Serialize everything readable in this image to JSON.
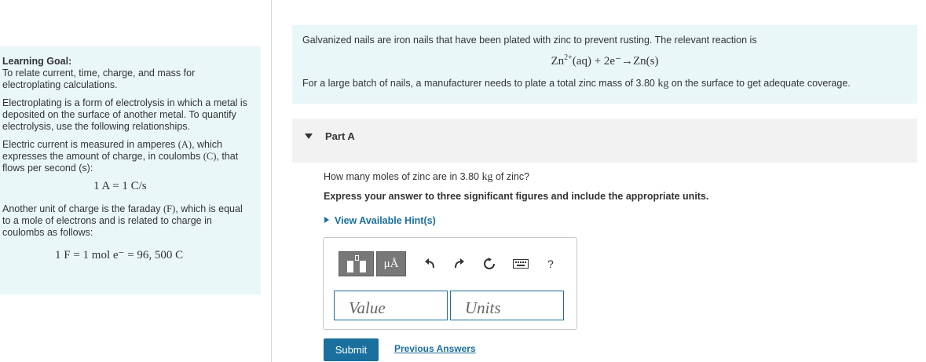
{
  "sidebar": {
    "goal_title": "Learning Goal:",
    "goal_text": "To relate current, time, charge, and mass for electroplating calculations.",
    "para1": "Electroplating is a form of electrolysis in which a metal is deposited on the surface of another metal. To quantify electrolysis, use the following relationships.",
    "para2_a": "Electric current is measured in amperes ",
    "para2_unit_a": "(A)",
    "para2_b": ", which expresses the amount of charge, in coulombs ",
    "para2_unit_c": "(C)",
    "para2_c": ", that flows per second (s):",
    "equation1": "1 A = 1 C/s",
    "para3_a": "Another unit of charge is the faraday ",
    "para3_unit_f": "(F)",
    "para3_b": ", which is equal to a mole of electrons and is related to charge in coulombs as follows:",
    "equation2": "1 F = 1 mol e⁻ = 96, 500 C"
  },
  "intro": {
    "text1": "Galvanized nails are iron nails that have been plated with zinc to prevent rusting. The relevant reaction is",
    "reaction_base": "Zn",
    "reaction_charge": "2+",
    "reaction_rest": "(aq) + 2e⁻→Zn(s)",
    "text2_a": "For a large batch of nails, a manufacturer needs to plate a total zinc mass of 3.80 ",
    "text2_unit": "kg",
    "text2_b": " on the surface to get adequate coverage."
  },
  "part": {
    "label": "Part A",
    "question_a": "How many moles of zinc are in 3.80 ",
    "question_unit": "kg",
    "question_b": " of zinc?",
    "instructions": "Express your answer to three significant figures and include the appropriate units.",
    "hints_label": "View Available Hint(s)"
  },
  "toolbar": {
    "units_button_label": "μÅ",
    "icons": [
      "templates-icon",
      "units-icon",
      "undo-icon",
      "redo-icon",
      "reset-icon",
      "keyboard-icon",
      "help-icon"
    ],
    "help_label": "?"
  },
  "answer": {
    "value_placeholder": "Value",
    "units_placeholder": "Units"
  },
  "actions": {
    "submit_label": "Submit",
    "previous_answers_label": "Previous Answers"
  },
  "colors": {
    "accent": "#1a6f9e",
    "panel_bg": "#eaf7f8",
    "part_header_bg": "#f2f2f2",
    "toolbar_button": "#787878"
  }
}
